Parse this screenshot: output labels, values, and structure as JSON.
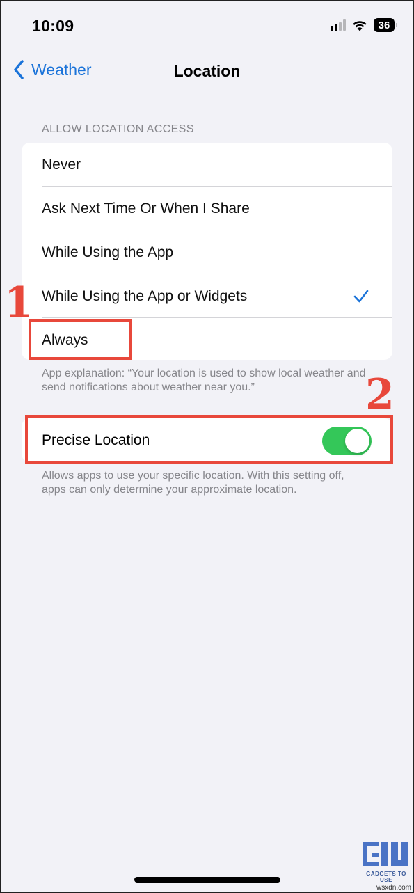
{
  "status_bar": {
    "time": "10:09",
    "battery": "36",
    "icons": [
      "cellular-signal-icon",
      "wifi-icon",
      "battery-icon"
    ]
  },
  "nav": {
    "back_label": "Weather",
    "title": "Location"
  },
  "section": {
    "header": "ALLOW LOCATION ACCESS",
    "options": [
      {
        "label": "Never",
        "selected": false
      },
      {
        "label": "Ask Next Time Or When I Share",
        "selected": false
      },
      {
        "label": "While Using the App",
        "selected": false
      },
      {
        "label": "While Using the App or Widgets",
        "selected": true
      },
      {
        "label": "Always",
        "selected": false
      }
    ],
    "explanation": "App explanation: “Your location is used to show local weather and send notifications about weather near you.”"
  },
  "precise": {
    "label": "Precise Location",
    "enabled": true,
    "footnote": "Allows apps to use your specific location. With this setting off, apps can only determine your approximate location."
  },
  "annotations": {
    "step1": "1",
    "step2": "2"
  },
  "watermark": {
    "logo_text": "GADGETS TO USE",
    "site": "wsxdn.com"
  },
  "colors": {
    "accent": "#1a73d9",
    "toggle_on": "#34c759",
    "annotation_red": "#e8483b",
    "background": "#f2f2f7"
  }
}
